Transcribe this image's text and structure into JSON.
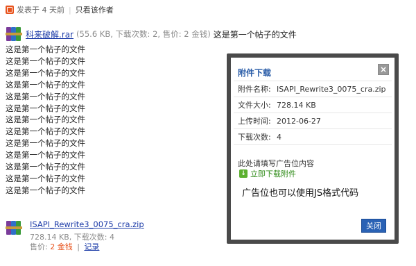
{
  "meta": {
    "posted_label": "发表于 4 天前",
    "author_only_link": "只看该作者"
  },
  "attachment1": {
    "filename": "科来破解.rar",
    "info": "(55.6 KB, 下载次数: 2, 售价: 2 金钱)",
    "title": "这是第一个帖子的文件"
  },
  "body_lines": [
    "这是第一个帖子的文件",
    "这是第一个帖子的文件",
    "这是第一个帖子的文件",
    "这是第一个帖子的文件",
    "这是第一个帖子的文件",
    "这是第一个帖子的文件",
    "这是第一个帖子的文件",
    "这是第一个帖子的文件",
    "这是第一个帖子的文件",
    "这是第一个帖子的文件",
    "这是第一个帖子的文件",
    "这是第一个帖子的文件",
    "这是第一个帖子的文件"
  ],
  "attachment2": {
    "filename": "ISAPI_Rewrite3_0075_cra.zip",
    "info": "728.14 KB, 下载次数: 4",
    "price_label": "售价:",
    "price_value": "2 金钱",
    "separator": "|",
    "log_link": "记录"
  },
  "dialog": {
    "title": "附件下载",
    "close_glyph": "×",
    "rows": [
      {
        "key": "附件名称:",
        "value": "ISAPI_Rewrite3_0075_cra.zip"
      },
      {
        "key": "文件大小:",
        "value": "728.14 KB"
      },
      {
        "key": "上传时间:",
        "value": "2012-06-27"
      },
      {
        "key": "下载次数:",
        "value": "4"
      }
    ],
    "ad_label": "此处请填写广告位内容",
    "download_link": "立即下载附件",
    "ad_text": "广告位也可以使用JS格式代码",
    "close_button": "关闭"
  },
  "colors": {
    "link": "#1d3ca8",
    "accent": "#e8541e",
    "dialog_title": "#2a5da8",
    "button": "#2a62b5",
    "download_green": "#2d8a16"
  },
  "icons": {
    "post": "post-icon",
    "rar": "winrar-archive-icon",
    "close": "close-icon",
    "download": "download-icon"
  }
}
